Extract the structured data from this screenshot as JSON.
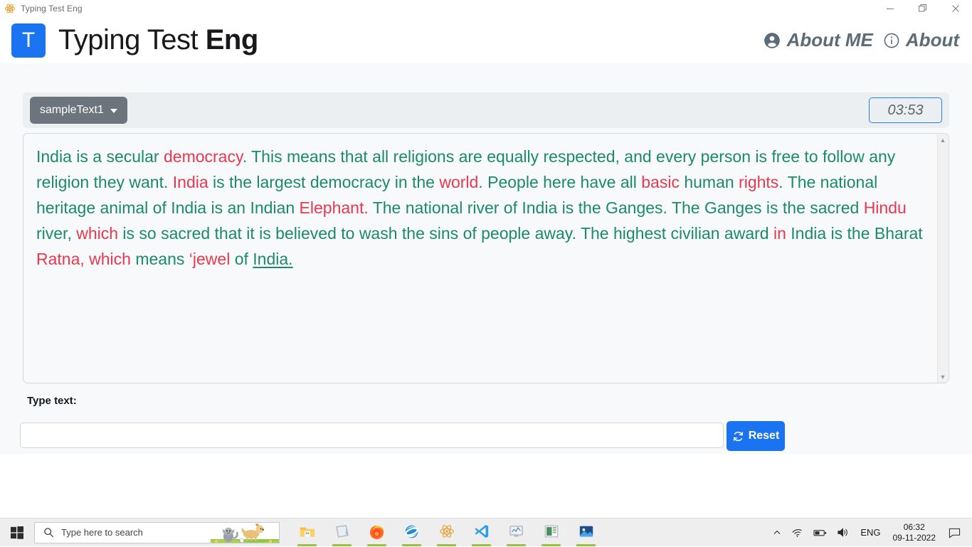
{
  "window": {
    "title": "Typing Test Eng",
    "icon": "atom-icon",
    "controls": {
      "minimize": "minimize-icon",
      "restore": "restore-icon",
      "close": "close-icon"
    }
  },
  "header": {
    "logo_letter": "T",
    "title_light": "Typing Test ",
    "title_bold": "Eng",
    "nav": [
      {
        "label": "About ME",
        "icon": "user-circle-icon"
      },
      {
        "label": "About",
        "icon": "info-circle-icon"
      }
    ]
  },
  "toolbar": {
    "dropdown_label": "sampleText1",
    "dropdown_icon": "chevron-down-icon",
    "timer": "03:53"
  },
  "sample": {
    "segments": [
      {
        "text": "India is a secular ",
        "state": "ok"
      },
      {
        "text": "democracy",
        "state": "bad"
      },
      {
        "text": ". This means that all religions are equally respected, and every person is free to follow any religion they want. ",
        "state": "ok"
      },
      {
        "text": "India",
        "state": "bad"
      },
      {
        "text": " is the largest democracy in the ",
        "state": "ok"
      },
      {
        "text": "world",
        "state": "bad"
      },
      {
        "text": ". People here have all ",
        "state": "ok"
      },
      {
        "text": "basic",
        "state": "bad"
      },
      {
        "text": " human ",
        "state": "ok"
      },
      {
        "text": "rights",
        "state": "bad"
      },
      {
        "text": ". The national heritage animal of India is an Indian ",
        "state": "ok"
      },
      {
        "text": "Elephant.",
        "state": "bad"
      },
      {
        "text": " The national river of India is the Ganges. The Ganges is the sacred ",
        "state": "ok"
      },
      {
        "text": "Hindu",
        "state": "bad"
      },
      {
        "text": " river, ",
        "state": "ok"
      },
      {
        "text": "which",
        "state": "bad"
      },
      {
        "text": " is so sacred that it is believed to wash the sins of people away. The highest civilian award ",
        "state": "ok"
      },
      {
        "text": "in",
        "state": "bad"
      },
      {
        "text": " India is the Bharat ",
        "state": "ok"
      },
      {
        "text": "Ratna, which",
        "state": "bad"
      },
      {
        "text": " means ",
        "state": "ok"
      },
      {
        "text": "‘jewel",
        "state": "bad"
      },
      {
        "text": " of ",
        "state": "ok"
      },
      {
        "text": "India.",
        "state": "cur"
      }
    ],
    "scrollbar": {
      "up": "scroll-up-arrow",
      "down": "scroll-down-arrow"
    }
  },
  "input_area": {
    "label": "Type text:",
    "value": "",
    "placeholder": "",
    "reset_label": "Reset",
    "reset_icon": "refresh-icon"
  },
  "taskbar": {
    "start_icon": "windows-start-icon",
    "search_placeholder": "Type here to search",
    "search_icon": "search-icon",
    "search_art": "cat-and-dog-illustration",
    "apps": [
      {
        "name": "file-explorer",
        "active": true
      },
      {
        "name": "sticky-notes",
        "active": true
      },
      {
        "name": "firefox",
        "active": true
      },
      {
        "name": "internet-explorer",
        "active": true
      },
      {
        "name": "electron",
        "active": true
      },
      {
        "name": "visual-studio-code",
        "active": true
      },
      {
        "name": "task-manager",
        "active": true
      },
      {
        "name": "powerpoint",
        "active": true
      },
      {
        "name": "photos",
        "active": true
      }
    ],
    "tray": {
      "overflow_icon": "chevron-up-icon",
      "network_icon": "wifi-icon",
      "battery_icon": "battery-icon",
      "volume_icon": "speaker-icon",
      "language": "ENG",
      "time": "06:32",
      "date": "09-11-2022",
      "notification_icon": "chat-bubble-icon"
    }
  },
  "colors": {
    "accent": "#1a73f0",
    "correct": "#1a8a6a",
    "incorrect": "#e8384f",
    "dropdown": "#6c757d",
    "panel": "#f8f9fa",
    "toolbar": "#eceff1",
    "nav_text": "#5b6b78"
  }
}
